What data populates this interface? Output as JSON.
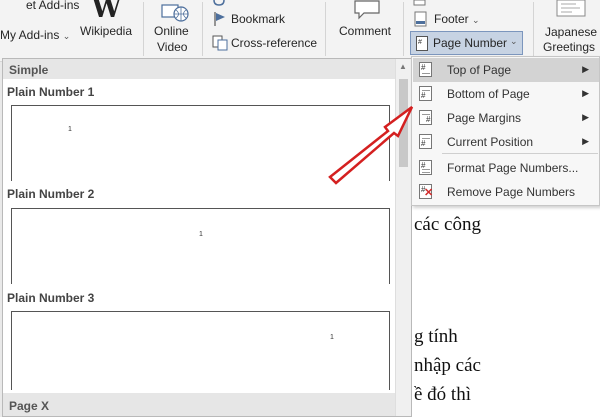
{
  "ribbon": {
    "get_addins": "et Add-ins",
    "my_addins": "My Add-ins",
    "wikipedia": "Wikipedia",
    "wiki_logo": "W",
    "online_video_1": "Online",
    "online_video_2": "Video",
    "bookmark": "Bookmark",
    "cross_reference": "Cross-reference",
    "comment": "Comment",
    "footer": "Footer",
    "page_number": "Page Number",
    "japanese_1": "Japanese",
    "japanese_2": "Greetings"
  },
  "gallery": {
    "section_simple": "Simple",
    "items": [
      {
        "label": "Plain Number 1",
        "page_num": "1"
      },
      {
        "label": "Plain Number 2",
        "page_num": "1"
      },
      {
        "label": "Plain Number 3",
        "page_num": "1"
      }
    ],
    "section_pagex": "Page X"
  },
  "menu": {
    "items": [
      {
        "label": "Top of Page",
        "has_submenu": true
      },
      {
        "label": "Bottom of Page",
        "has_submenu": true
      },
      {
        "label": "Page Margins",
        "has_submenu": true
      },
      {
        "label": "Current Position",
        "has_submenu": true
      },
      {
        "label": "Format Page Numbers...",
        "has_submenu": false
      },
      {
        "label": "Remove Page Numbers",
        "has_submenu": false
      }
    ],
    "active_index": 0
  },
  "document": {
    "line1": "các công",
    "line2": "g tính",
    "line3": "nhập các",
    "line4": "ề đó thì"
  },
  "annotation": {
    "arrow_color": "#d42020"
  }
}
